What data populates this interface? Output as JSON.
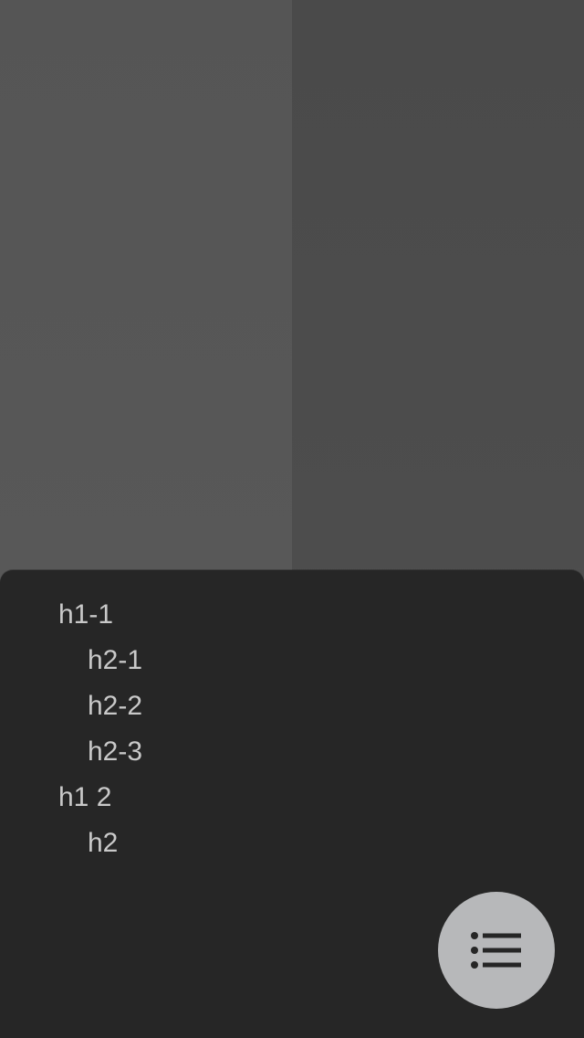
{
  "toc": {
    "items": [
      {
        "label": "h1-1",
        "level": 1
      },
      {
        "label": "h2-1",
        "level": 2
      },
      {
        "label": "h2-2",
        "level": 2
      },
      {
        "label": "h2-3",
        "level": 2
      },
      {
        "label": "h1 2",
        "level": 1
      },
      {
        "label": "h2",
        "level": 2
      }
    ]
  },
  "fab": {
    "icon": "list-icon",
    "background": "#b7b8ba",
    "icon_color": "#262626"
  },
  "colors": {
    "sheet_background": "#262626",
    "text": "#c9c9c9",
    "left_pane": "#555555",
    "right_pane": "#4a4a4a"
  }
}
